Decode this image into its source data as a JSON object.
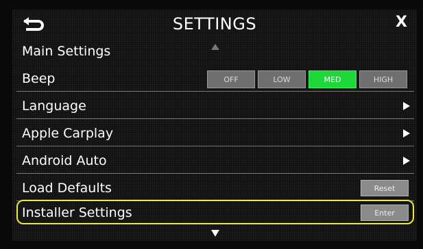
{
  "header": {
    "title": "SETTINGS",
    "close_label": "X",
    "back_icon": "back-arrow-icon"
  },
  "section": {
    "title": "Main Settings"
  },
  "rows": [
    {
      "label": "Beep",
      "options": [
        "OFF",
        "LOW",
        "MED",
        "HIGH"
      ],
      "selected": "MED"
    },
    {
      "label": "Language",
      "action": "chevron-right"
    },
    {
      "label": "Apple Carplay",
      "action": "chevron-right"
    },
    {
      "label": "Android Auto",
      "action": "chevron-right"
    },
    {
      "label": "Load Defaults",
      "button": "Reset"
    },
    {
      "label": "Installer Settings",
      "button": "Enter",
      "highlighted": true
    }
  ],
  "colors": {
    "active_option": "#1ed83a",
    "highlight_outline": "#f0ea3c",
    "button_gray": "#8a8a8a"
  }
}
